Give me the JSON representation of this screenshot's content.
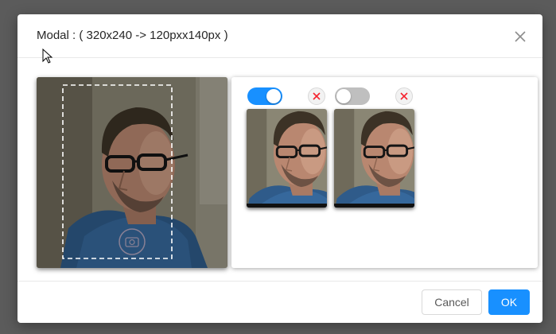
{
  "modal": {
    "title": "Modal : ( 320x240 -> 120pxx140px )",
    "close_icon": "close-icon"
  },
  "camera": {
    "selection_frame_icon": "dashed-crop-frame",
    "capture_icon": "camera-icon"
  },
  "thumbnails": [
    {
      "enabled": true,
      "toggle_icon": "switch-on",
      "remove_icon": "close-circle-icon"
    },
    {
      "enabled": false,
      "toggle_icon": "switch-off",
      "remove_icon": "close-circle-icon"
    }
  ],
  "footer": {
    "cancel_label": "Cancel",
    "ok_label": "OK"
  },
  "colors": {
    "primary": "#1890ff",
    "danger": "#f5222d",
    "overlay": "#5b5b5b"
  }
}
